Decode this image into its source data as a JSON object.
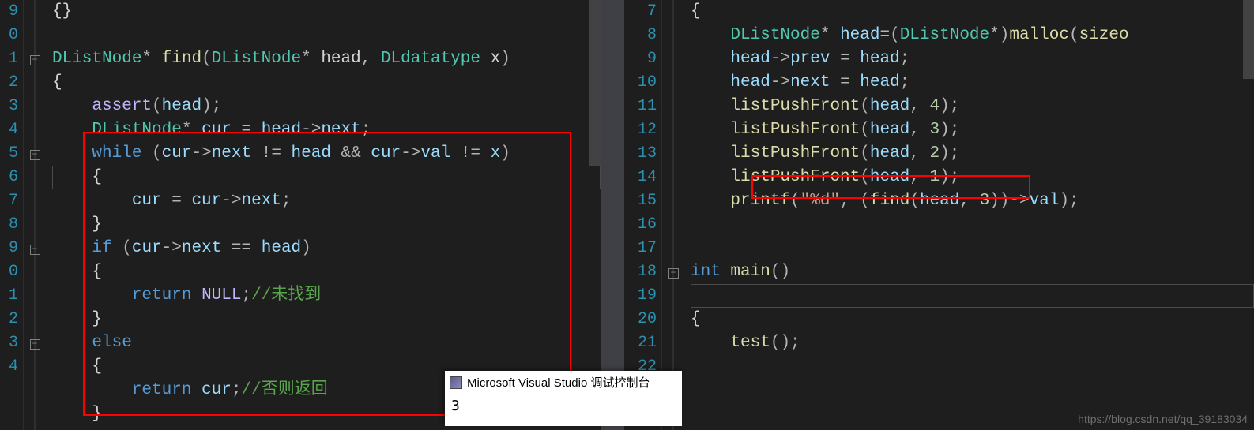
{
  "left": {
    "lineNumbers": [
      "",
      "",
      "9",
      "0",
      "1",
      "2",
      "3",
      "4",
      "5",
      "6",
      "7",
      "8",
      "9",
      "0",
      "1",
      "2",
      "3",
      "4"
    ],
    "folds": {
      "2": "-",
      "6": "-",
      "10": "-",
      "14": "-"
    },
    "code": [
      {
        "plain": "{}"
      },
      {
        "plain": ""
      },
      {
        "tokens": [
          [
            "typ",
            "DListNode"
          ],
          [
            "op",
            "* "
          ],
          [
            "fn",
            "find"
          ],
          [
            "paren",
            "("
          ],
          [
            "typ",
            "DListNode"
          ],
          [
            "op",
            "* "
          ],
          [
            "par",
            "head"
          ],
          [
            "op",
            ", "
          ],
          [
            "typ",
            "DLdatatype"
          ],
          [
            "par",
            " x"
          ],
          [
            "paren",
            ")"
          ]
        ]
      },
      {
        "tokens": [
          [
            "brace",
            "{"
          ]
        ]
      },
      {
        "tokens": [
          [
            "",
            "    "
          ],
          [
            "mac",
            "assert"
          ],
          [
            "paren",
            "("
          ],
          [
            "id",
            "head"
          ],
          [
            "paren",
            ")"
          ],
          [
            "op",
            ";"
          ]
        ]
      },
      {
        "tokens": [
          [
            "",
            "    "
          ],
          [
            "typ",
            "DListNode"
          ],
          [
            "op",
            "* "
          ],
          [
            "id",
            "cur"
          ],
          [
            "op",
            " = "
          ],
          [
            "id",
            "head"
          ],
          [
            "op",
            "->"
          ],
          [
            "id",
            "next"
          ],
          [
            "op",
            ";"
          ]
        ]
      },
      {
        "tokens": [
          [
            "",
            "    "
          ],
          [
            "kw",
            "while"
          ],
          [
            "paren",
            " ("
          ],
          [
            "id",
            "cur"
          ],
          [
            "op",
            "->"
          ],
          [
            "id",
            "next"
          ],
          [
            "op",
            " != "
          ],
          [
            "id",
            "head"
          ],
          [
            "op",
            " && "
          ],
          [
            "id",
            "cur"
          ],
          [
            "op",
            "->"
          ],
          [
            "id",
            "val"
          ],
          [
            "op",
            " != "
          ],
          [
            "id",
            "x"
          ],
          [
            "paren",
            ")"
          ]
        ]
      },
      {
        "tokens": [
          [
            "",
            "    "
          ],
          [
            "brace",
            "{"
          ]
        ],
        "active": true
      },
      {
        "tokens": [
          [
            "",
            "        "
          ],
          [
            "id",
            "cur"
          ],
          [
            "op",
            " = "
          ],
          [
            "id",
            "cur"
          ],
          [
            "op",
            "->"
          ],
          [
            "id",
            "next"
          ],
          [
            "op",
            ";"
          ]
        ]
      },
      {
        "tokens": [
          [
            "",
            "    "
          ],
          [
            "brace",
            "}"
          ]
        ]
      },
      {
        "tokens": [
          [
            "",
            "    "
          ],
          [
            "kw",
            "if"
          ],
          [
            "paren",
            " ("
          ],
          [
            "id",
            "cur"
          ],
          [
            "op",
            "->"
          ],
          [
            "id",
            "next"
          ],
          [
            "op",
            " == "
          ],
          [
            "id",
            "head"
          ],
          [
            "paren",
            ")"
          ]
        ]
      },
      {
        "tokens": [
          [
            "",
            "    "
          ],
          [
            "brace",
            "{"
          ]
        ]
      },
      {
        "tokens": [
          [
            "",
            "        "
          ],
          [
            "kw",
            "return"
          ],
          [
            "",
            " "
          ],
          [
            "null",
            "NULL"
          ],
          [
            "op",
            ";"
          ],
          [
            "cmt",
            "//未找到"
          ]
        ]
      },
      {
        "tokens": [
          [
            "",
            "    "
          ],
          [
            "brace",
            "}"
          ]
        ]
      },
      {
        "tokens": [
          [
            "",
            "    "
          ],
          [
            "kw",
            "else"
          ]
        ]
      },
      {
        "tokens": [
          [
            "",
            "    "
          ],
          [
            "brace",
            "{"
          ]
        ]
      },
      {
        "tokens": [
          [
            "",
            "        "
          ],
          [
            "kw",
            "return"
          ],
          [
            "",
            " "
          ],
          [
            "id",
            "cur"
          ],
          [
            "op",
            ";"
          ],
          [
            "cmt",
            "//否则返回"
          ]
        ]
      },
      {
        "tokens": [
          [
            "",
            "    "
          ],
          [
            "brace",
            "}"
          ]
        ]
      }
    ]
  },
  "right": {
    "lineNumbers": [
      "7",
      "8",
      "9",
      "10",
      "11",
      "12",
      "13",
      "14",
      "15",
      "16",
      "17",
      "18",
      "19",
      "20",
      "21",
      "22"
    ],
    "folds": {
      "11": "-"
    },
    "code": [
      {
        "tokens": [
          [
            "brace",
            "{"
          ]
        ]
      },
      {
        "tokens": [
          [
            "",
            "    "
          ],
          [
            "typ",
            "DListNode"
          ],
          [
            "op",
            "* "
          ],
          [
            "id",
            "head"
          ],
          [
            "op",
            "="
          ],
          [
            "paren",
            "("
          ],
          [
            "typ",
            "DListNode"
          ],
          [
            "op",
            "*"
          ],
          [
            "paren",
            ")"
          ],
          [
            "fn",
            "malloc"
          ],
          [
            "paren",
            "("
          ],
          [
            "fn",
            "sizeo"
          ]
        ]
      },
      {
        "tokens": [
          [
            "",
            "    "
          ],
          [
            "id",
            "head"
          ],
          [
            "op",
            "->"
          ],
          [
            "id",
            "prev"
          ],
          [
            "op",
            " = "
          ],
          [
            "id",
            "head"
          ],
          [
            "op",
            ";"
          ]
        ]
      },
      {
        "tokens": [
          [
            "",
            "    "
          ],
          [
            "id",
            "head"
          ],
          [
            "op",
            "->"
          ],
          [
            "id",
            "next"
          ],
          [
            "op",
            " = "
          ],
          [
            "id",
            "head"
          ],
          [
            "op",
            ";"
          ]
        ]
      },
      {
        "tokens": [
          [
            "",
            "    "
          ],
          [
            "fn",
            "listPushFront"
          ],
          [
            "paren",
            "("
          ],
          [
            "id",
            "head"
          ],
          [
            "op",
            ", "
          ],
          [
            "num",
            "4"
          ],
          [
            "paren",
            ")"
          ],
          [
            "op",
            ";"
          ]
        ]
      },
      {
        "tokens": [
          [
            "",
            "    "
          ],
          [
            "fn",
            "listPushFront"
          ],
          [
            "paren",
            "("
          ],
          [
            "id",
            "head"
          ],
          [
            "op",
            ", "
          ],
          [
            "num",
            "3"
          ],
          [
            "paren",
            ")"
          ],
          [
            "op",
            ";"
          ]
        ]
      },
      {
        "tokens": [
          [
            "",
            "    "
          ],
          [
            "fn",
            "listPushFront"
          ],
          [
            "paren",
            "("
          ],
          [
            "id",
            "head"
          ],
          [
            "op",
            ", "
          ],
          [
            "num",
            "2"
          ],
          [
            "paren",
            ")"
          ],
          [
            "op",
            ";"
          ]
        ]
      },
      {
        "tokens": [
          [
            "",
            "    "
          ],
          [
            "fn",
            "listPushFront"
          ],
          [
            "paren",
            "("
          ],
          [
            "id",
            "head"
          ],
          [
            "op",
            ", "
          ],
          [
            "num",
            "1"
          ],
          [
            "paren",
            ")"
          ],
          [
            "op",
            ";"
          ]
        ]
      },
      {
        "tokens": [
          [
            "",
            "    "
          ],
          [
            "fn",
            "printf"
          ],
          [
            "paren",
            "("
          ],
          [
            "str",
            "\"%d\""
          ],
          [
            "op",
            ", "
          ],
          [
            "paren",
            "("
          ],
          [
            "fn",
            "find"
          ],
          [
            "paren",
            "("
          ],
          [
            "id",
            "head"
          ],
          [
            "op",
            ", "
          ],
          [
            "num",
            "3"
          ],
          [
            "paren",
            "))"
          ],
          [
            "op",
            "->"
          ],
          [
            "id",
            "val"
          ],
          [
            "paren",
            ")"
          ],
          [
            "op",
            ";"
          ]
        ]
      },
      {
        "plain": ""
      },
      {
        "plain": ""
      },
      {
        "tokens": [
          [
            "kw",
            "int"
          ],
          [
            "",
            " "
          ],
          [
            "fn",
            "main"
          ],
          [
            "paren",
            "()"
          ]
        ]
      },
      {
        "plain": "",
        "active": true
      },
      {
        "tokens": [
          [
            "brace",
            "{"
          ]
        ]
      },
      {
        "tokens": [
          [
            "",
            "    "
          ],
          [
            "fn",
            "test"
          ],
          [
            "paren",
            "()"
          ],
          [
            "op",
            ";"
          ]
        ]
      },
      {
        "plain": ""
      }
    ]
  },
  "console": {
    "title": "Microsoft Visual Studio 调试控制台",
    "output": "3"
  },
  "watermark": "https://blog.csdn.net/qq_39183034",
  "foldMinus": "−"
}
